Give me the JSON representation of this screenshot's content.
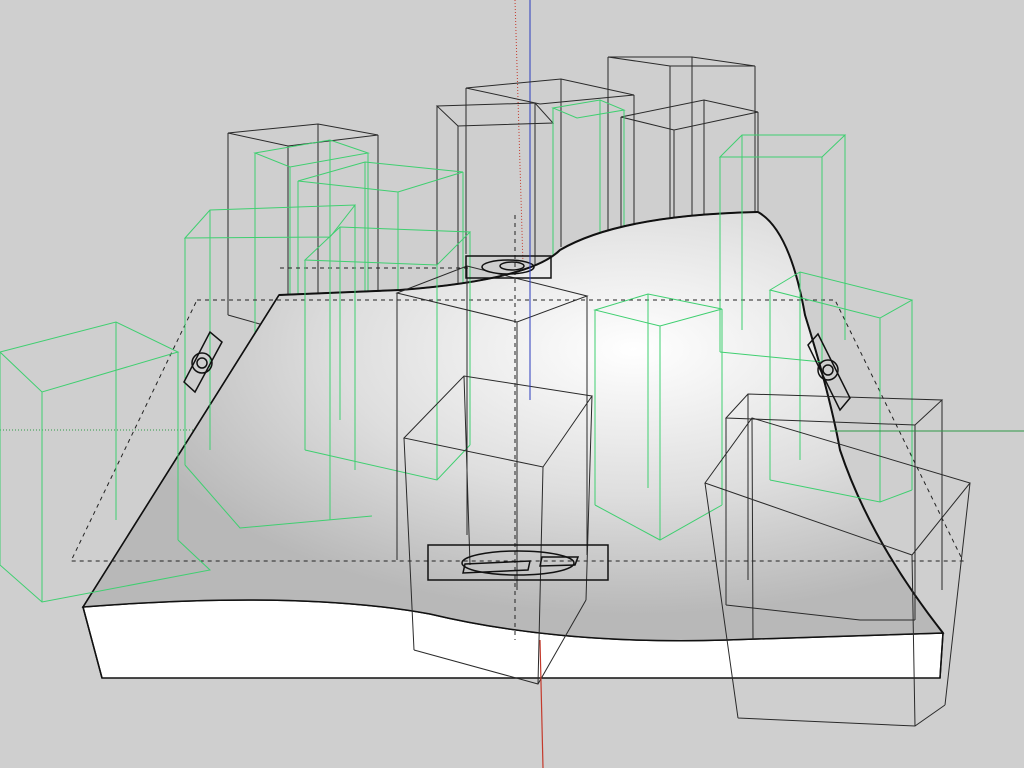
{
  "colors": {
    "background": "#cfcfcf",
    "red_axis": "#c43a2c",
    "green_axis": "#2f9a47",
    "blue_axis": "#2a3bbd",
    "green_wireframe": "#3fcf70",
    "black_wireframe": "#2a2a2a",
    "terrain_side": "#ffffff",
    "terrain_top_dark": "#b9b9b9",
    "terrain_top_light": "#ffffff",
    "guide_dashed": "#222222"
  }
}
